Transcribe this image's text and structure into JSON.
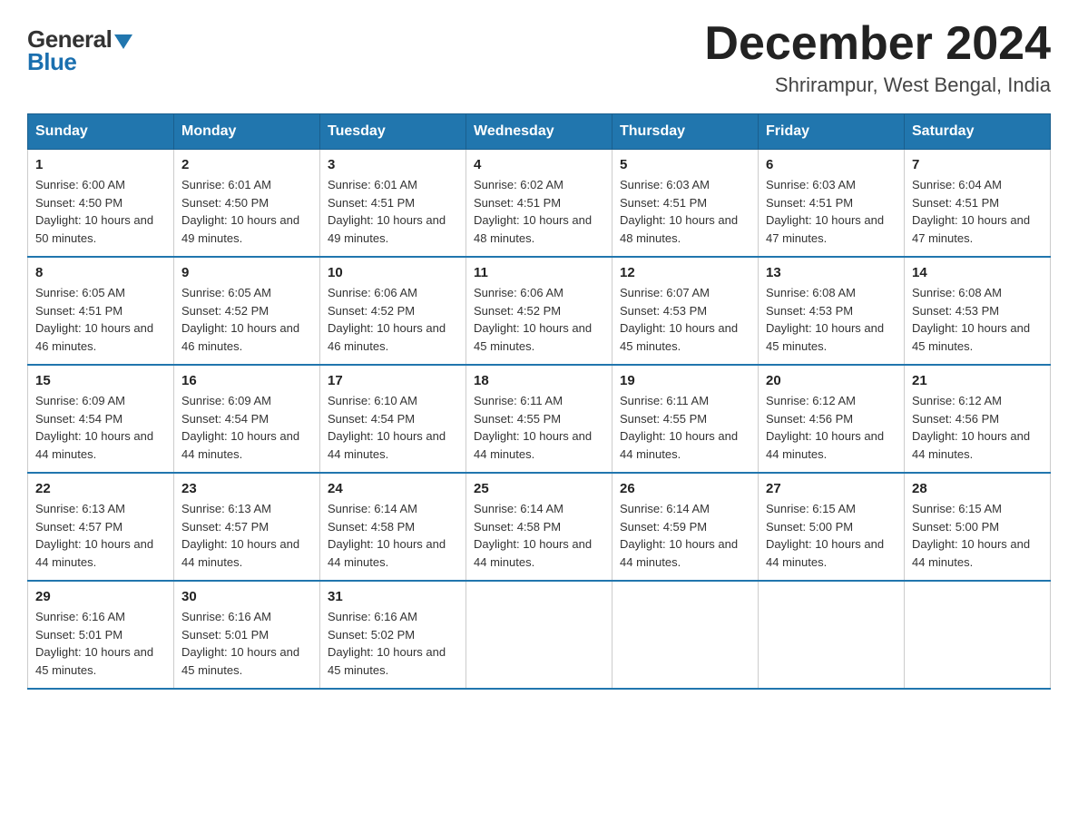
{
  "header": {
    "logo_general": "General",
    "logo_blue": "Blue",
    "month_title": "December 2024",
    "location": "Shrirampur, West Bengal, India"
  },
  "days_of_week": [
    "Sunday",
    "Monday",
    "Tuesday",
    "Wednesday",
    "Thursday",
    "Friday",
    "Saturday"
  ],
  "weeks": [
    [
      {
        "day": "1",
        "sunrise": "6:00 AM",
        "sunset": "4:50 PM",
        "daylight": "10 hours and 50 minutes."
      },
      {
        "day": "2",
        "sunrise": "6:01 AM",
        "sunset": "4:50 PM",
        "daylight": "10 hours and 49 minutes."
      },
      {
        "day": "3",
        "sunrise": "6:01 AM",
        "sunset": "4:51 PM",
        "daylight": "10 hours and 49 minutes."
      },
      {
        "day": "4",
        "sunrise": "6:02 AM",
        "sunset": "4:51 PM",
        "daylight": "10 hours and 48 minutes."
      },
      {
        "day": "5",
        "sunrise": "6:03 AM",
        "sunset": "4:51 PM",
        "daylight": "10 hours and 48 minutes."
      },
      {
        "day": "6",
        "sunrise": "6:03 AM",
        "sunset": "4:51 PM",
        "daylight": "10 hours and 47 minutes."
      },
      {
        "day": "7",
        "sunrise": "6:04 AM",
        "sunset": "4:51 PM",
        "daylight": "10 hours and 47 minutes."
      }
    ],
    [
      {
        "day": "8",
        "sunrise": "6:05 AM",
        "sunset": "4:51 PM",
        "daylight": "10 hours and 46 minutes."
      },
      {
        "day": "9",
        "sunrise": "6:05 AM",
        "sunset": "4:52 PM",
        "daylight": "10 hours and 46 minutes."
      },
      {
        "day": "10",
        "sunrise": "6:06 AM",
        "sunset": "4:52 PM",
        "daylight": "10 hours and 46 minutes."
      },
      {
        "day": "11",
        "sunrise": "6:06 AM",
        "sunset": "4:52 PM",
        "daylight": "10 hours and 45 minutes."
      },
      {
        "day": "12",
        "sunrise": "6:07 AM",
        "sunset": "4:53 PM",
        "daylight": "10 hours and 45 minutes."
      },
      {
        "day": "13",
        "sunrise": "6:08 AM",
        "sunset": "4:53 PM",
        "daylight": "10 hours and 45 minutes."
      },
      {
        "day": "14",
        "sunrise": "6:08 AM",
        "sunset": "4:53 PM",
        "daylight": "10 hours and 45 minutes."
      }
    ],
    [
      {
        "day": "15",
        "sunrise": "6:09 AM",
        "sunset": "4:54 PM",
        "daylight": "10 hours and 44 minutes."
      },
      {
        "day": "16",
        "sunrise": "6:09 AM",
        "sunset": "4:54 PM",
        "daylight": "10 hours and 44 minutes."
      },
      {
        "day": "17",
        "sunrise": "6:10 AM",
        "sunset": "4:54 PM",
        "daylight": "10 hours and 44 minutes."
      },
      {
        "day": "18",
        "sunrise": "6:11 AM",
        "sunset": "4:55 PM",
        "daylight": "10 hours and 44 minutes."
      },
      {
        "day": "19",
        "sunrise": "6:11 AM",
        "sunset": "4:55 PM",
        "daylight": "10 hours and 44 minutes."
      },
      {
        "day": "20",
        "sunrise": "6:12 AM",
        "sunset": "4:56 PM",
        "daylight": "10 hours and 44 minutes."
      },
      {
        "day": "21",
        "sunrise": "6:12 AM",
        "sunset": "4:56 PM",
        "daylight": "10 hours and 44 minutes."
      }
    ],
    [
      {
        "day": "22",
        "sunrise": "6:13 AM",
        "sunset": "4:57 PM",
        "daylight": "10 hours and 44 minutes."
      },
      {
        "day": "23",
        "sunrise": "6:13 AM",
        "sunset": "4:57 PM",
        "daylight": "10 hours and 44 minutes."
      },
      {
        "day": "24",
        "sunrise": "6:14 AM",
        "sunset": "4:58 PM",
        "daylight": "10 hours and 44 minutes."
      },
      {
        "day": "25",
        "sunrise": "6:14 AM",
        "sunset": "4:58 PM",
        "daylight": "10 hours and 44 minutes."
      },
      {
        "day": "26",
        "sunrise": "6:14 AM",
        "sunset": "4:59 PM",
        "daylight": "10 hours and 44 minutes."
      },
      {
        "day": "27",
        "sunrise": "6:15 AM",
        "sunset": "5:00 PM",
        "daylight": "10 hours and 44 minutes."
      },
      {
        "day": "28",
        "sunrise": "6:15 AM",
        "sunset": "5:00 PM",
        "daylight": "10 hours and 44 minutes."
      }
    ],
    [
      {
        "day": "29",
        "sunrise": "6:16 AM",
        "sunset": "5:01 PM",
        "daylight": "10 hours and 45 minutes."
      },
      {
        "day": "30",
        "sunrise": "6:16 AM",
        "sunset": "5:01 PM",
        "daylight": "10 hours and 45 minutes."
      },
      {
        "day": "31",
        "sunrise": "6:16 AM",
        "sunset": "5:02 PM",
        "daylight": "10 hours and 45 minutes."
      },
      null,
      null,
      null,
      null
    ]
  ]
}
